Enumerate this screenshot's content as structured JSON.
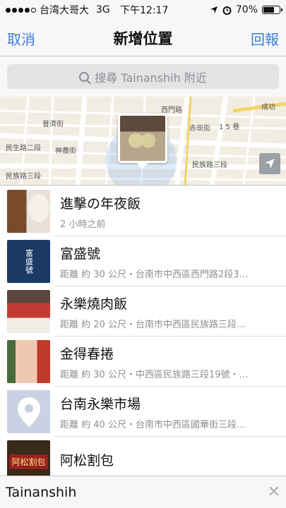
{
  "status_bar": {
    "carrier": "台湾大哥大",
    "network": "3G",
    "time": "下午12:17",
    "battery": "70%",
    "battery_level": 0.7
  },
  "nav": {
    "cancel_label": "取消",
    "title": "新增位置",
    "report_label": "回報"
  },
  "search": {
    "placeholder": "搜尋 Tainanshih 附近"
  },
  "map": {
    "labels": [
      "成功",
      "赤崁街",
      "民生路二段",
      "神農街",
      "民族路三段",
      "民族路三段",
      "西門路",
      "普濟街",
      "1 5 巷"
    ]
  },
  "places": [
    {
      "title": "進擊の年夜飯",
      "subtitle": "2 小時之前",
      "icon": "photo-thumbnail"
    },
    {
      "title": "富盛號",
      "subtitle": "距離 約 30 公尺・台南市中西區西門路2段3…",
      "icon": "shop-logo-thumbnail",
      "thumb_text": "富盛號"
    },
    {
      "title": "永樂燒肉飯",
      "subtitle": "距離 約 20 公尺・台南市中西區民族路三段…",
      "icon": "photo-thumbnail"
    },
    {
      "title": "金得春捲",
      "subtitle": "距離 約 30 公尺・中西區民族路三段19號・…",
      "icon": "photo-thumbnail"
    },
    {
      "title": "台南永樂市場",
      "subtitle": "距離 約 40 公尺・台南市中西區國華街三段…",
      "icon": "location-pin-icon"
    },
    {
      "title": "阿松割包",
      "subtitle": "",
      "icon": "shop-sign-thumbnail",
      "thumb_text": "阿松割包"
    }
  ],
  "bottom": {
    "text": "Tainanshih",
    "clear_icon": "close-icon"
  },
  "colors": {
    "accent": "#3b7dd8",
    "secondary_text": "#8e8e93"
  }
}
